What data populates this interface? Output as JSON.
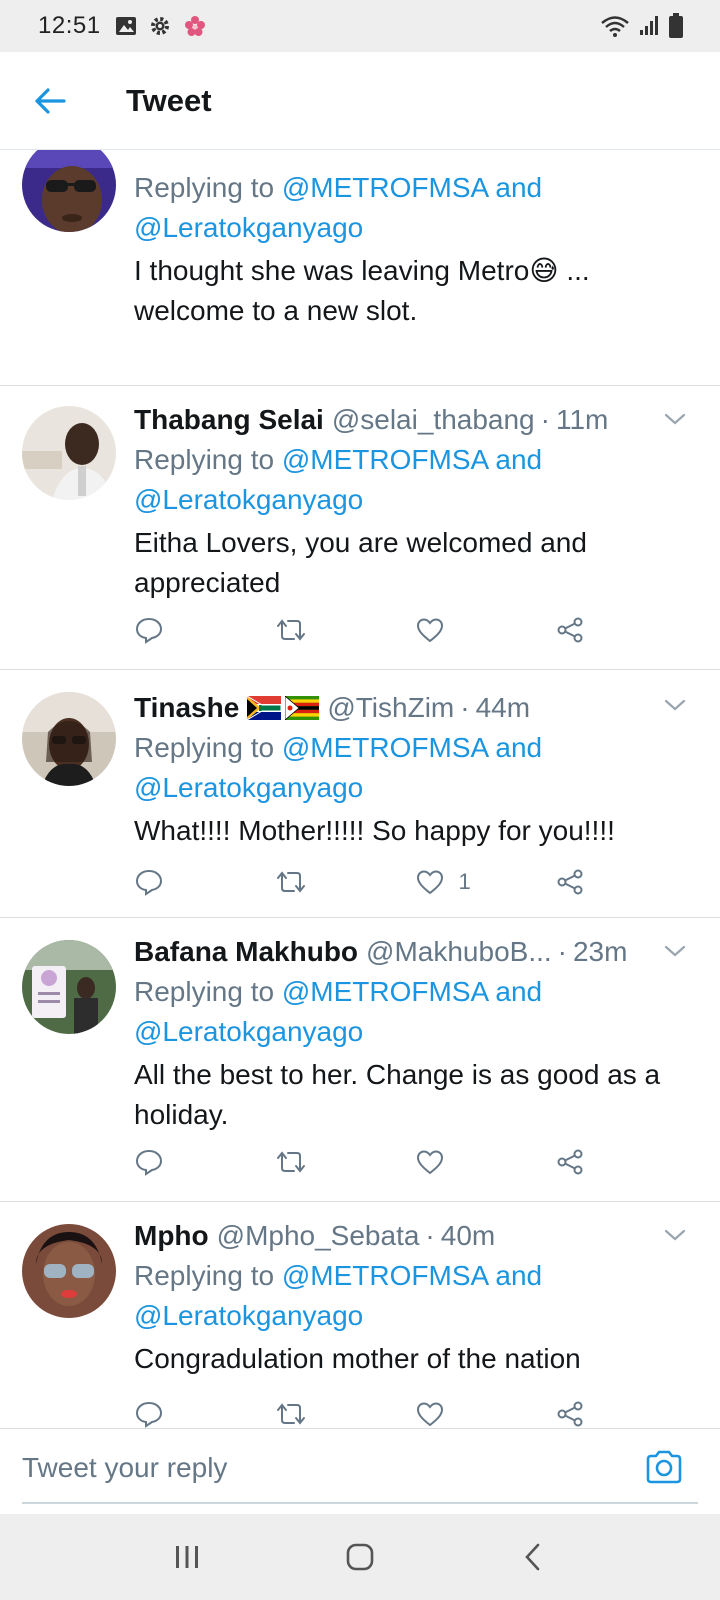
{
  "status_bar": {
    "time": "12:51"
  },
  "header": {
    "title": "Tweet"
  },
  "reply_prefix": "Replying to",
  "tweets": [
    {
      "name": "",
      "handle": "",
      "time": "",
      "mention_1": "@METROFMSA and",
      "mention_2": "@Leratokganyago",
      "text_line_1": "I thought she was leaving Metro",
      "text_emoji": "😅",
      "text_line_1_tail": " ...",
      "text_line_2": "welcome to a new slot.",
      "like_count": ""
    },
    {
      "name": "Thabang Selai",
      "handle": "@selai_thabang",
      "time": "11m",
      "mention_1": "@METROFMSA and",
      "mention_2": "@Leratokganyago",
      "text_line_1": "Eitha Lovers, you are welcomed and",
      "text_line_2": "appreciated",
      "like_count": ""
    },
    {
      "name": "Tinashe",
      "handle": "@TishZim",
      "time": "44m",
      "mention_1": "@METROFMSA and",
      "mention_2": "@Leratokganyago",
      "text_line_1": "What!!!! Mother!!!!! So happy for you!!!!",
      "like_count": "1"
    },
    {
      "name": "Bafana Makhubo",
      "handle": "@MakhuboB...",
      "time": "23m",
      "mention_1": "@METROFMSA and",
      "mention_2": "@Leratokganyago",
      "text_line_1": "All the best to her. Change is as good as a",
      "text_line_2": "holiday.",
      "like_count": ""
    },
    {
      "name": "Mpho",
      "handle": "@Mpho_Sebata",
      "time": "40m",
      "mention_1": "@METROFMSA and",
      "mention_2": "@Leratokganyago",
      "text_line_1": "Congradulation mother of the nation",
      "like_count": ""
    }
  ],
  "composer": {
    "placeholder": "Tweet your reply"
  },
  "colors": {
    "accent": "#1b95e0",
    "secondary_text": "#657786",
    "divider": "#d9dee2"
  },
  "icons": {
    "status": [
      "gallery-icon",
      "settings-icon",
      "flower-icon",
      "wifi-icon",
      "signal-icon",
      "battery-icon"
    ],
    "tweet_actions": [
      "reply-icon",
      "retweet-icon",
      "like-icon",
      "share-icon"
    ],
    "nav": [
      "recent-apps-icon",
      "home-icon",
      "back-icon"
    ]
  }
}
